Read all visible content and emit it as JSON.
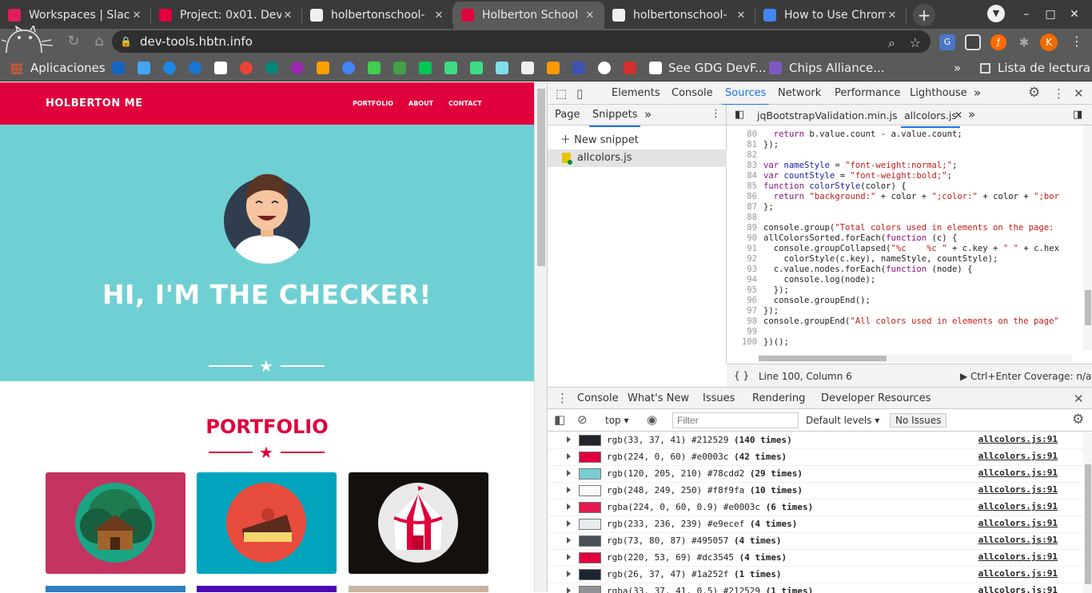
{
  "browser": {
    "tabs": [
      {
        "title": "Workspaces | Slack",
        "favicon_color": "#e01e5a",
        "active": false
      },
      {
        "title": "Project: 0x01. Dev",
        "favicon_color": "#e0003c",
        "active": false
      },
      {
        "title": "holbertonschool-",
        "favicon_color": "#f0f0f0",
        "active": false
      },
      {
        "title": "Holberton School",
        "favicon_color": "#e0003c",
        "active": true
      },
      {
        "title": "holbertonschool-",
        "favicon_color": "#f0f0f0",
        "active": false
      },
      {
        "title": "How to Use Chrom",
        "favicon_color": "#4285f4",
        "active": false
      }
    ],
    "tab_close": "✕",
    "new_tab": "+",
    "window_controls": {
      "minimize": "–",
      "maximize": "□",
      "close": "✕"
    },
    "url": "dev-tools.hbtn.info",
    "profile_initial": "K",
    "bookmarks": {
      "apps_label": "Aplicaciones",
      "gdg_label": "See GDG DevF...",
      "chips_label": "Chips Alliance...",
      "more": "»",
      "reading_list": "Lista de lectura"
    }
  },
  "site": {
    "brand": "HOLBERTON ME",
    "nav": [
      "PORTFOLIO",
      "ABOUT",
      "CONTACT"
    ],
    "hero_title": "HI, I'M THE CHECKER!",
    "star": "★",
    "portfolio_title": "PORTFOLIO",
    "colors": {
      "primary": "#e0003c",
      "hero": "#6fd0d4"
    },
    "cards": [
      {
        "name": "cabin",
        "bg": "#c53360"
      },
      {
        "name": "cake",
        "bg": "#00a5bd"
      },
      {
        "name": "circus",
        "bg": "#14100e"
      }
    ],
    "cards_row2": [
      "#2f7dbf",
      "#4a0ab1",
      "#c8b3a0"
    ]
  },
  "devtools": {
    "main_tabs": [
      "Elements",
      "Console",
      "Sources",
      "Network",
      "Performance",
      "Lighthouse"
    ],
    "active_main_tab": "Sources",
    "more_tabs": "»",
    "nav_tabs": [
      "Page",
      "Snippets"
    ],
    "new_snippet": "New snippet",
    "snippet_file": "allcolors.js",
    "editor_tabs": [
      "jqBootstrapValidation.min.js",
      "allcolors.js"
    ],
    "code_lines": [
      {
        "n": "80",
        "html": "  <span class='kw'>return</span> b.value.count - a.value.count;"
      },
      {
        "n": "81",
        "html": "});"
      },
      {
        "n": "82",
        "html": ""
      },
      {
        "n": "83",
        "html": "<span class='kw'>var</span> <span class='fn'>nameStyle</span> = <span class='st'>\"font-weight:normal;\"</span>;"
      },
      {
        "n": "84",
        "html": "<span class='kw'>var</span> <span class='fn'>countStyle</span> = <span class='st'>\"font-weight:bold;\"</span>;"
      },
      {
        "n": "85",
        "html": "<span class='kw'>function</span> <span class='fn'>colorStyle</span>(color) {"
      },
      {
        "n": "86",
        "html": "  <span class='kw'>return</span> <span class='st'>\"background:\"</span> + color + <span class='st'>\";color:\"</span> + color + <span class='st'>\";bor</span>"
      },
      {
        "n": "87",
        "html": "};"
      },
      {
        "n": "88",
        "html": ""
      },
      {
        "n": "89",
        "html": "console.group(<span class='st'>\"Total colors used in elements on the page:</span>"
      },
      {
        "n": "90",
        "html": "allColorsSorted.forEach(<span class='kw'>function</span> (c) {"
      },
      {
        "n": "91",
        "html": "  console.groupCollapsed(<span class='st'>\"%c    %c \"</span> + c.key + <span class='st'>\" \"</span> + c.hex"
      },
      {
        "n": "92",
        "html": "    colorStyle(c.key), nameStyle, countStyle);"
      },
      {
        "n": "93",
        "html": "  c.value.nodes.forEach(<span class='kw'>function</span> (node) {"
      },
      {
        "n": "94",
        "html": "    console.log(node);"
      },
      {
        "n": "95",
        "html": "  });"
      },
      {
        "n": "96",
        "html": "  console.groupEnd();"
      },
      {
        "n": "97",
        "html": "});"
      },
      {
        "n": "98",
        "html": "console.groupEnd(<span class='st'>\"All colors used in elements on the page\"</span>"
      },
      {
        "n": "99",
        "html": ""
      },
      {
        "n": "100",
        "html": "})();"
      }
    ],
    "status": {
      "braces": "{ }",
      "cursor": "Line 100, Column 6",
      "run": "▶ Ctrl+Enter",
      "coverage": "Coverage: n/a"
    },
    "drawer_tabs": [
      "Console",
      "What's New",
      "Issues",
      "Rendering",
      "Developer Resources"
    ],
    "console_toolbar": {
      "context": "top",
      "filter_placeholder": "Filter",
      "levels": "Default levels",
      "issues": "No Issues"
    },
    "logs": [
      {
        "color": "#212529",
        "text": "rgb(33, 37, 41) #212529",
        "count": "(140 times)",
        "src": "allcolors.js:91"
      },
      {
        "color": "#e0003c",
        "text": "rgb(224, 0, 60) #e0003c",
        "count": "(42 times)",
        "src": "allcolors.js:91"
      },
      {
        "color": "#78cdd2",
        "text": "rgb(120, 205, 210) #78cdd2",
        "count": "(29 times)",
        "src": "allcolors.js:91"
      },
      {
        "color": "#f8f9fa",
        "text": "rgb(248, 249, 250) #f8f9fa",
        "count": "(10 times)",
        "src": "allcolors.js:91"
      },
      {
        "color": "#e6194f",
        "text": "rgba(224, 0, 60, 0.9) #e0003c",
        "count": "(6 times)",
        "src": "allcolors.js:91"
      },
      {
        "color": "#e9ecef",
        "text": "rgb(233, 236, 239) #e9ecef",
        "count": "(4 times)",
        "src": "allcolors.js:91"
      },
      {
        "color": "#495057",
        "text": "rgb(73, 80, 87) #495057",
        "count": "(4 times)",
        "src": "allcolors.js:91"
      },
      {
        "color": "#e0003c",
        "text": "rgb(220, 53, 69) #dc3545",
        "count": "(4 times)",
        "src": "allcolors.js:91"
      },
      {
        "color": "#1a252f",
        "text": "rgb(26, 37, 47) #1a252f",
        "count": "(1 times)",
        "src": "allcolors.js:91"
      },
      {
        "color": "#909294",
        "text": "rgba(33, 37, 41, 0.5) #212529",
        "count": "(1 times)",
        "src": "allcolors.js:91"
      }
    ]
  }
}
